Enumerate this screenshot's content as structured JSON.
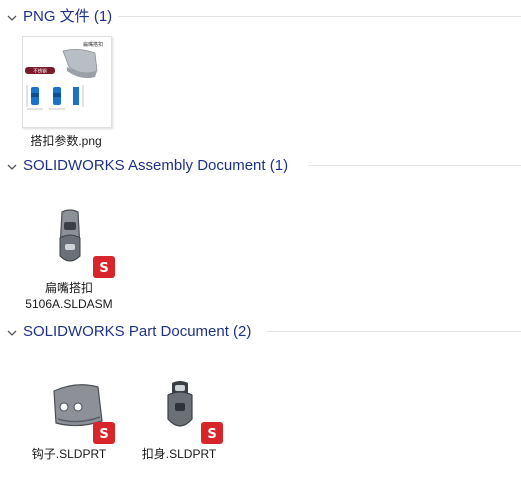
{
  "groups": [
    {
      "title": "PNG 文件 (1)",
      "files": [
        {
          "name": "搭扣参数.png",
          "thumb_title": "扁嘴搭扣",
          "thumb_tag": "不锈钢"
        }
      ]
    },
    {
      "title": "SOLIDWORKS Assembly Document (1)",
      "files": [
        {
          "name_line1": "扁嘴搭扣",
          "name_line2": "5106A.SLDASM"
        }
      ]
    },
    {
      "title": "SOLIDWORKS Part Document (2)",
      "files": [
        {
          "name": "钩子.SLDPRT"
        },
        {
          "name": "扣身.SLDPRT"
        }
      ]
    }
  ],
  "icons": {
    "chevron": "chevron-down-icon",
    "solidworks": "solidworks-icon"
  },
  "colors": {
    "group_title": "#1e3287",
    "solidworks_red": "#d7252b",
    "thumb_tag": "#7a1a2a",
    "thumb_blue": "#1a73c8"
  }
}
